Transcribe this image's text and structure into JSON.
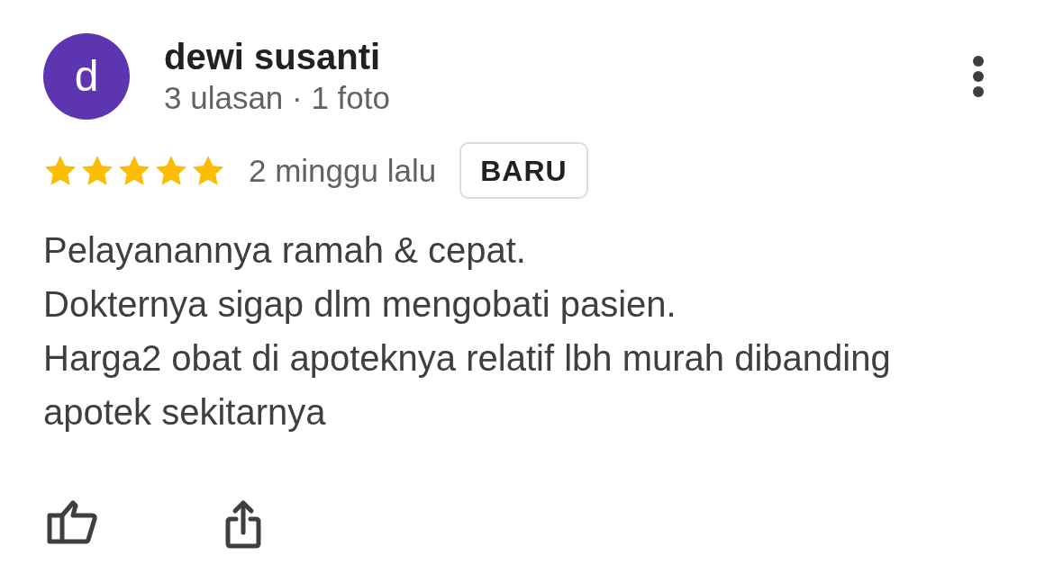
{
  "review": {
    "author": {
      "avatar_letter": "d",
      "name": "dewi susanti",
      "meta": "3 ulasan · 1 foto"
    },
    "stars": 5,
    "time": "2 minggu lalu",
    "badge": "BARU",
    "text": "Pelayanannya ramah & cepat.\nDokternya sigap dlm mengobati pasien.\nHarga2 obat di apoteknya relatif lbh murah dibanding apotek sekitarnya"
  }
}
